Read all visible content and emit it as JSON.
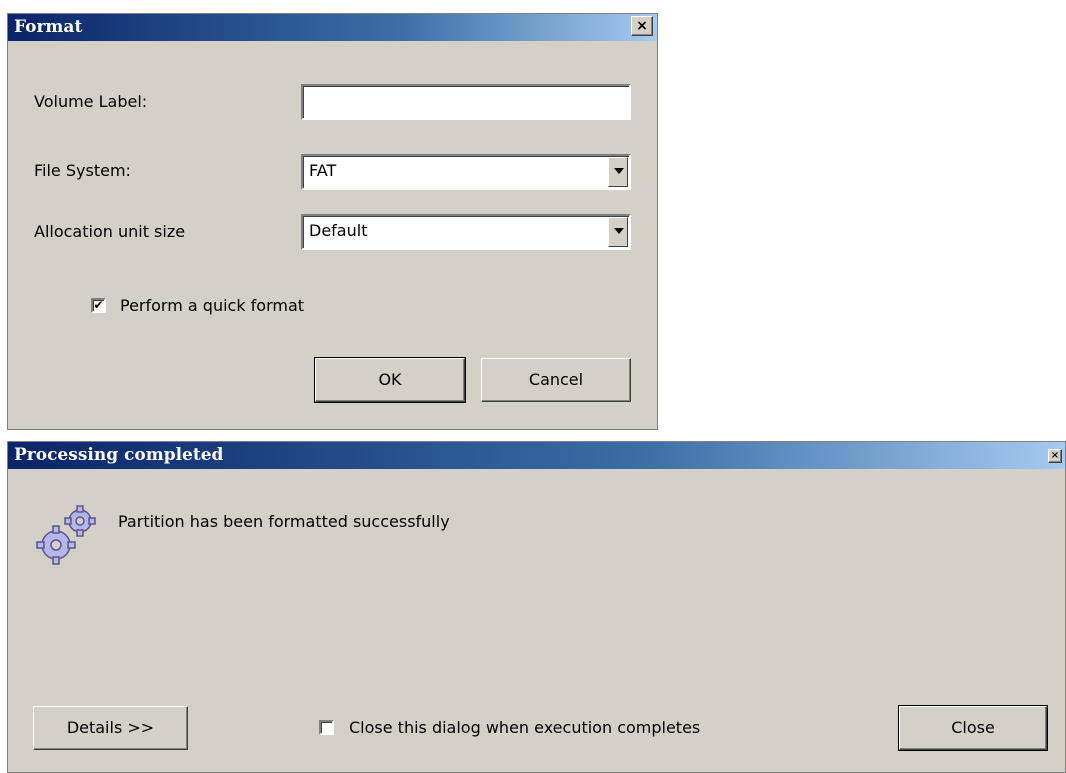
{
  "format_dialog": {
    "title": "Format",
    "close_glyph": "×",
    "volume_label": {
      "label": "Volume Label:",
      "value": ""
    },
    "file_system": {
      "label": "File System:",
      "value": "FAT"
    },
    "allocation_unit": {
      "label": "Allocation unit size",
      "value": "Default"
    },
    "quick_format": {
      "label": "Perform a quick format",
      "checked": true,
      "mark": "✔"
    },
    "ok_label": "OK",
    "cancel_label": "Cancel"
  },
  "processing_dialog": {
    "title": "Processing completed",
    "close_glyph": "×",
    "icon": "gears-icon",
    "message": "Partition has been formatted successfully",
    "details_label": "Details >>",
    "close_when_done": {
      "label": "Close this dialog when execution completes",
      "checked": false
    },
    "close_label": "Close"
  }
}
